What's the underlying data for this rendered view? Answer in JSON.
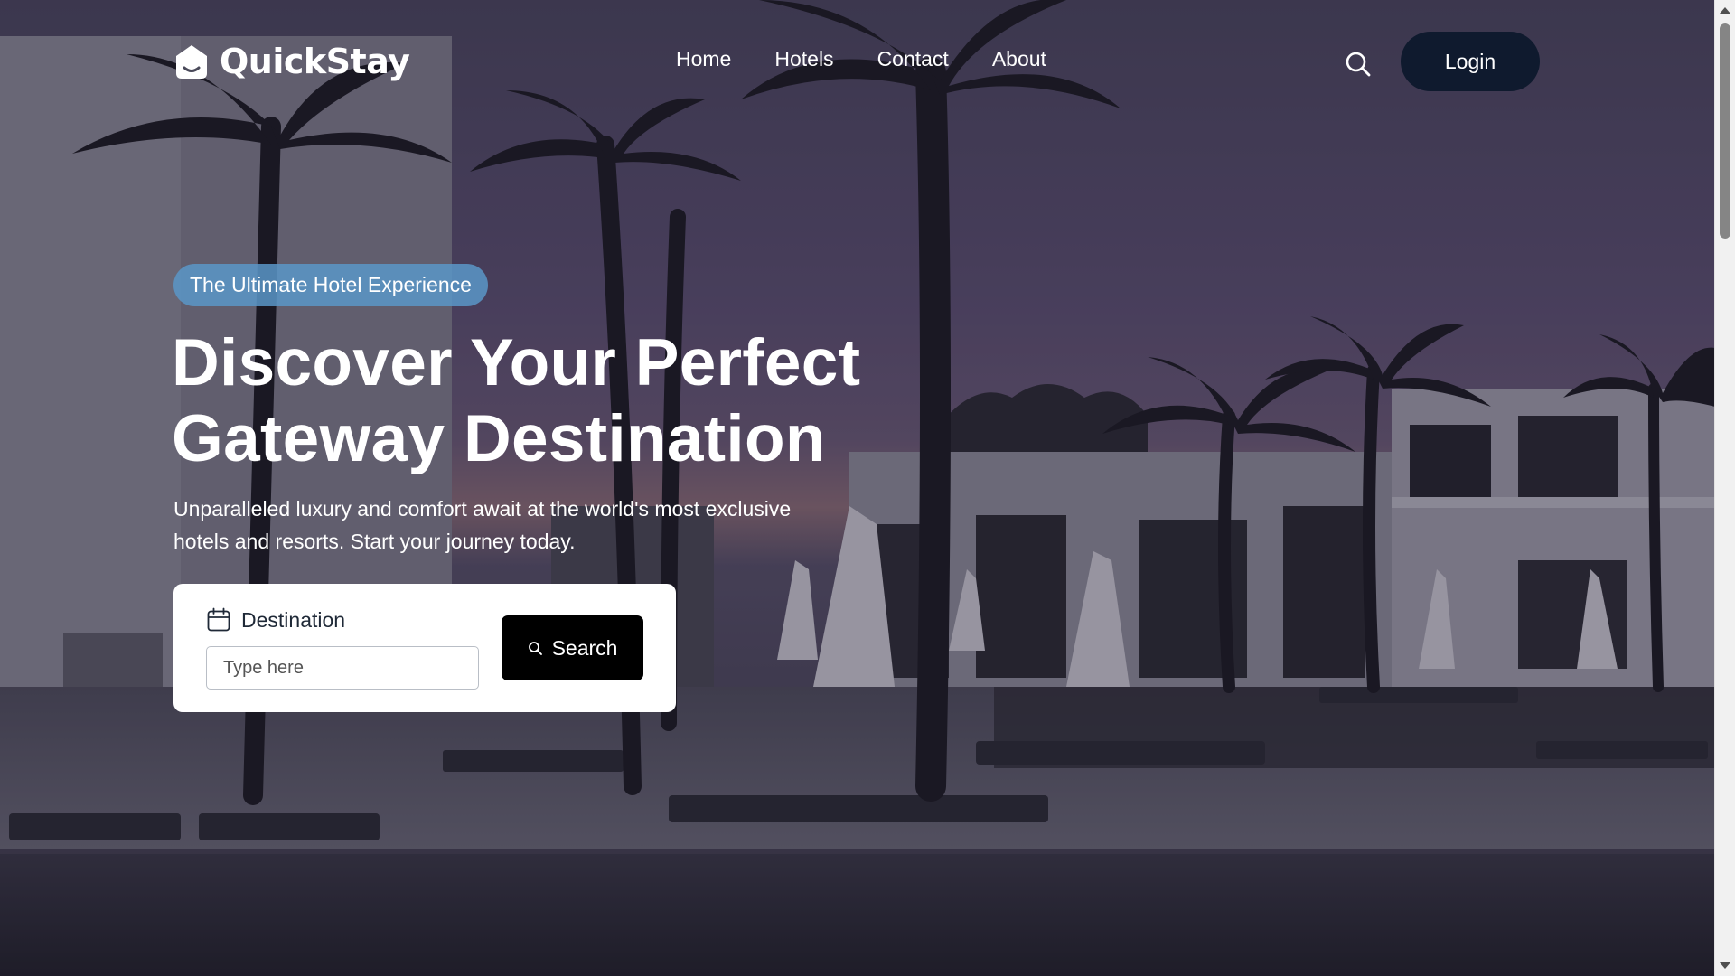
{
  "brand": {
    "name": "QuickStay",
    "logo_icon": "house-smile-icon"
  },
  "nav": {
    "items": [
      {
        "label": "Home"
      },
      {
        "label": "Hotels"
      },
      {
        "label": "Contact"
      },
      {
        "label": "About"
      }
    ],
    "search_icon": "search-icon",
    "login_label": "Login"
  },
  "hero": {
    "badge": "The Ultimate Hotel Experience",
    "title_line1": "Discover Your Perfect",
    "title_line2": "Gateway Destination",
    "subtitle": "Unparalleled luxury and comfort await at the world's most exclusive hotels and resorts. Start your journey today."
  },
  "search_form": {
    "destination_label": "Destination",
    "destination_icon": "calendar-icon",
    "destination_placeholder": "Type here",
    "destination_value": "",
    "submit_label": "Search",
    "submit_icon": "search-icon"
  },
  "colors": {
    "login_bg": "#0f1a2e",
    "badge_bg": "#5a96c8",
    "search_button_bg": "#000000",
    "card_bg": "#ffffff"
  }
}
